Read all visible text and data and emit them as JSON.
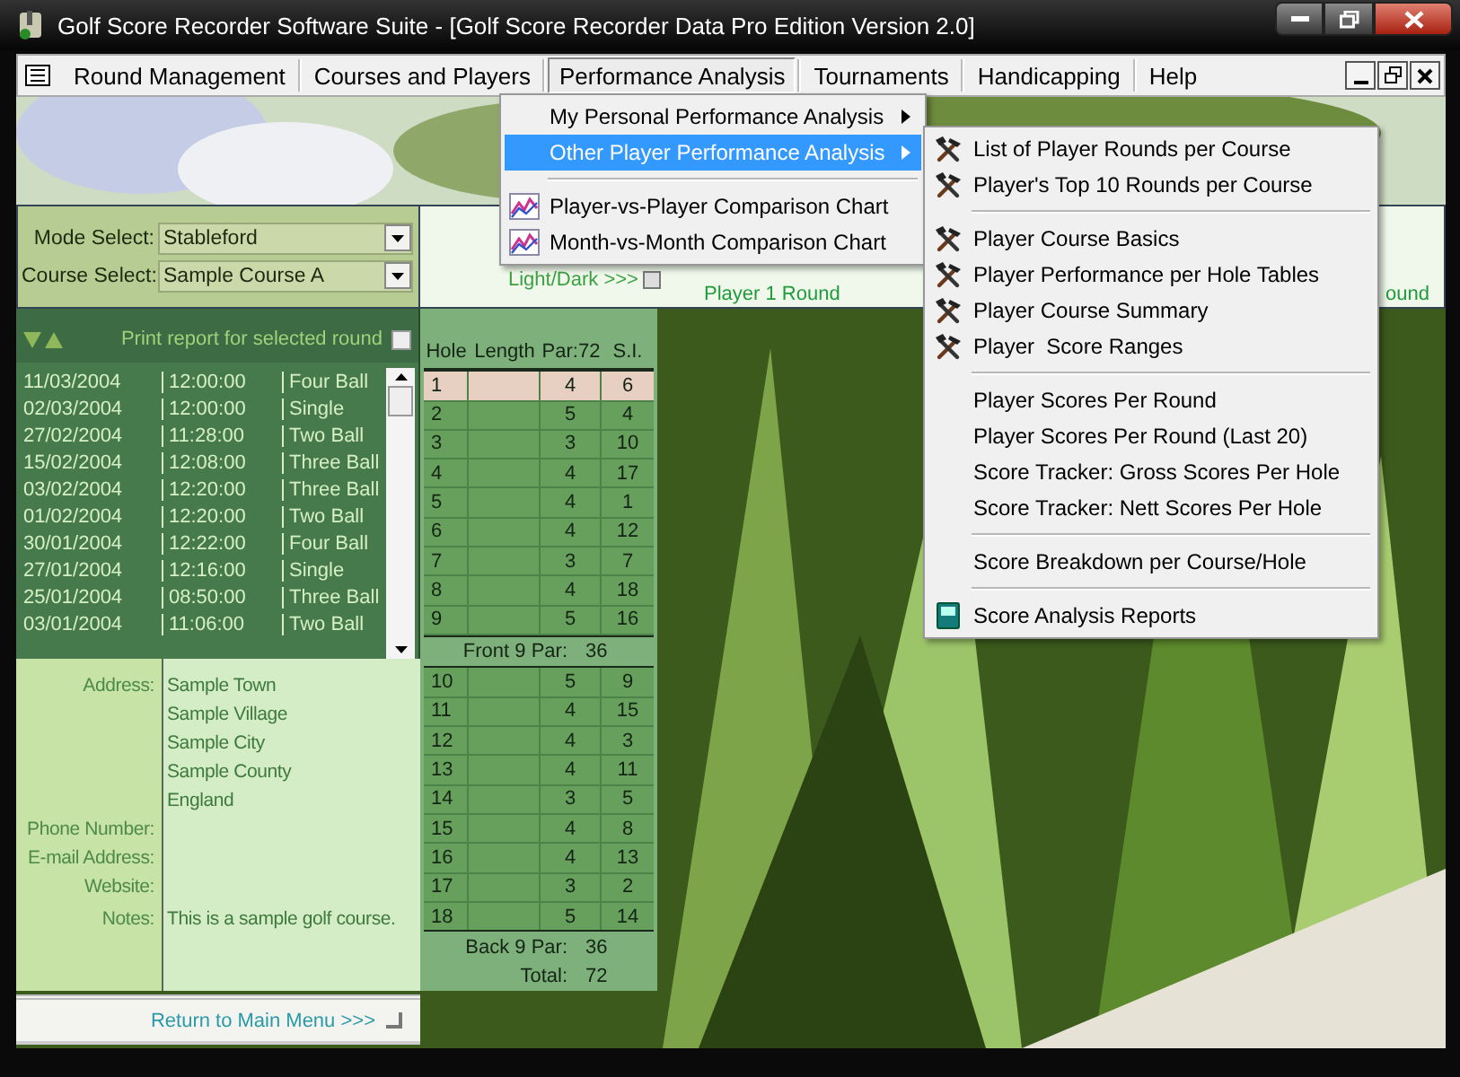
{
  "window": {
    "title": "Golf Score Recorder Software Suite - [Golf Score Recorder Data Pro Edition Version 2.0]"
  },
  "menu_bar": [
    {
      "label": "Round Management",
      "selected": false
    },
    {
      "label": "Courses and Players",
      "selected": false
    },
    {
      "label": "Performance Analysis",
      "selected": true
    },
    {
      "label": "Tournaments",
      "selected": false
    },
    {
      "label": "Handicapping",
      "selected": false
    },
    {
      "label": "Help",
      "selected": false
    }
  ],
  "dropdown": [
    {
      "kind": "submenu",
      "label": "My Personal Performance Analysis",
      "selected": false
    },
    {
      "kind": "submenu",
      "label": "Other Player Performance Analysis",
      "selected": true
    },
    {
      "kind": "separator"
    },
    {
      "kind": "chart",
      "label": "Player-vs-Player Comparison Chart",
      "selected": false
    },
    {
      "kind": "chart",
      "label": "Month-vs-Month Comparison Chart",
      "selected": false
    }
  ],
  "submenu": [
    {
      "kind": "tool",
      "label": "List of Player Rounds per Course",
      "selected": false
    },
    {
      "kind": "tool",
      "label": "Player's Top 10 Rounds per Course",
      "selected": false
    },
    {
      "kind": "separator"
    },
    {
      "kind": "tool",
      "label": "Player Course Basics",
      "selected": false
    },
    {
      "kind": "tool",
      "label": "Player Performance per Hole Tables",
      "selected": false
    },
    {
      "kind": "tool",
      "label": "Player Course Summary",
      "selected": false
    },
    {
      "kind": "tool",
      "label": "Player  Score Ranges",
      "selected": false
    },
    {
      "kind": "separator"
    },
    {
      "kind": "plain",
      "label": "Player Scores Per Round",
      "selected": false
    },
    {
      "kind": "plain",
      "label": "Player Scores Per Round (Last 20)",
      "selected": false
    },
    {
      "kind": "plain",
      "label": "Score Tracker: Gross Scores Per Hole",
      "selected": false
    },
    {
      "kind": "plain",
      "label": "Score Tracker: Nett Scores Per Hole",
      "selected": false
    },
    {
      "kind": "separator"
    },
    {
      "kind": "plain",
      "label": "Score Breakdown per Course/Hole",
      "selected": false
    },
    {
      "kind": "separator"
    },
    {
      "kind": "book",
      "label": "Score Analysis Reports",
      "selected": false
    }
  ],
  "filters": [
    {
      "label": "Mode Select:",
      "value": "Stableford"
    },
    {
      "label": "Course Select:",
      "value": "Sample Course A"
    }
  ],
  "strip": {
    "toggle": "Light/Dark >>>",
    "toggle_checked": false,
    "round_left": "Player 1 Round",
    "round_right": "ound"
  },
  "rounds": {
    "print_label": "Print report for selected round",
    "print_checked": false,
    "rows": [
      {
        "date": "11/03/2004",
        "time": "12:00:00",
        "type": "Four Ball"
      },
      {
        "date": "02/03/2004",
        "time": "12:00:00",
        "type": "Single"
      },
      {
        "date": "27/02/2004",
        "time": "11:28:00",
        "type": "Two Ball"
      },
      {
        "date": "15/02/2004",
        "time": "12:08:00",
        "type": "Three Ball"
      },
      {
        "date": "03/02/2004",
        "time": "12:20:00",
        "type": "Three Ball"
      },
      {
        "date": "01/02/2004",
        "time": "12:20:00",
        "type": "Two Ball"
      },
      {
        "date": "30/01/2004",
        "time": "12:22:00",
        "type": "Four Ball"
      },
      {
        "date": "27/01/2004",
        "time": "12:16:00",
        "type": "Single"
      },
      {
        "date": "25/01/2004",
        "time": "08:50:00",
        "type": "Three Ball"
      },
      {
        "date": "03/01/2004",
        "time": "11:06:00",
        "type": "Two Ball"
      }
    ]
  },
  "course": [
    {
      "label": "Address:",
      "values": [
        "Sample Town",
        "Sample Village",
        "Sample City",
        "Sample County",
        "England"
      ]
    },
    {
      "label": "Phone Number:"
    },
    {
      "label": "E-mail Address:"
    },
    {
      "label": "Website:"
    },
    {
      "label": "Notes:",
      "values": [
        "This is a sample golf course."
      ]
    }
  ],
  "holes": {
    "columns": [
      "Hole",
      "Length",
      "Par:72",
      "S.I."
    ],
    "front": [
      {
        "hole": "1",
        "par": "4",
        "si": "6",
        "selected": true
      },
      {
        "hole": "2",
        "par": "5",
        "si": "4",
        "selected": false
      },
      {
        "hole": "3",
        "par": "3",
        "si": "10",
        "selected": false
      },
      {
        "hole": "4",
        "par": "4",
        "si": "17",
        "selected": false
      },
      {
        "hole": "5",
        "par": "4",
        "si": "1",
        "selected": false
      },
      {
        "hole": "6",
        "par": "4",
        "si": "12",
        "selected": false
      },
      {
        "hole": "7",
        "par": "3",
        "si": "7",
        "selected": false
      },
      {
        "hole": "8",
        "par": "4",
        "si": "18",
        "selected": false
      },
      {
        "hole": "9",
        "par": "5",
        "si": "16",
        "selected": false
      }
    ],
    "front_label": "Front 9 Par:",
    "front_par": "36",
    "back": [
      {
        "hole": "10",
        "par": "5",
        "si": "9",
        "selected": false
      },
      {
        "hole": "11",
        "par": "4",
        "si": "15",
        "selected": false
      },
      {
        "hole": "12",
        "par": "4",
        "si": "3",
        "selected": false
      },
      {
        "hole": "13",
        "par": "4",
        "si": "11",
        "selected": false
      },
      {
        "hole": "14",
        "par": "3",
        "si": "5",
        "selected": false
      },
      {
        "hole": "15",
        "par": "4",
        "si": "8",
        "selected": false
      },
      {
        "hole": "16",
        "par": "4",
        "si": "13",
        "selected": false
      },
      {
        "hole": "17",
        "par": "3",
        "si": "2",
        "selected": false
      },
      {
        "hole": "18",
        "par": "5",
        "si": "14",
        "selected": false
      }
    ],
    "back_label": "Back 9 Par:",
    "back_par": "36",
    "total_label": "Total:",
    "total": "72"
  },
  "footer": {
    "link": "Return to Main Menu >>>"
  }
}
